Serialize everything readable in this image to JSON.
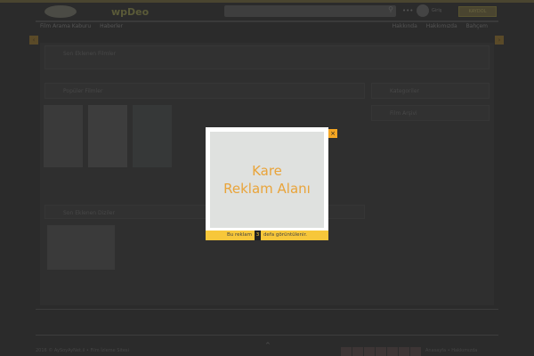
{
  "header": {
    "logo": "wpDeo",
    "search_placeholder": "",
    "login": "Giriş",
    "register": "KAYDOL"
  },
  "nav": {
    "left": [
      "Film Arama Kaburu",
      "Haberler"
    ],
    "right": [
      "Hakkında",
      "Hakkımızda",
      "Bahçem"
    ]
  },
  "sections": {
    "first": "Son Eklenen Filmler",
    "second": "Popüler Filmler",
    "third": "Son Eklenen Diziler",
    "side1": "Kategoriler",
    "side2": "Film Arşivi"
  },
  "modal": {
    "ad_line1": "Kare",
    "ad_line2": "Reklam Alanı",
    "footer_pre": "Bu reklam",
    "count": "3",
    "footer_post": "defa görüntülenir.",
    "close": "×"
  },
  "footer": {
    "copyright": "2016 © AySoyAyNet.il • Film İzleme Sitesi",
    "links": [
      "Anasayfa",
      "Hakkımızda"
    ],
    "up": "^"
  }
}
